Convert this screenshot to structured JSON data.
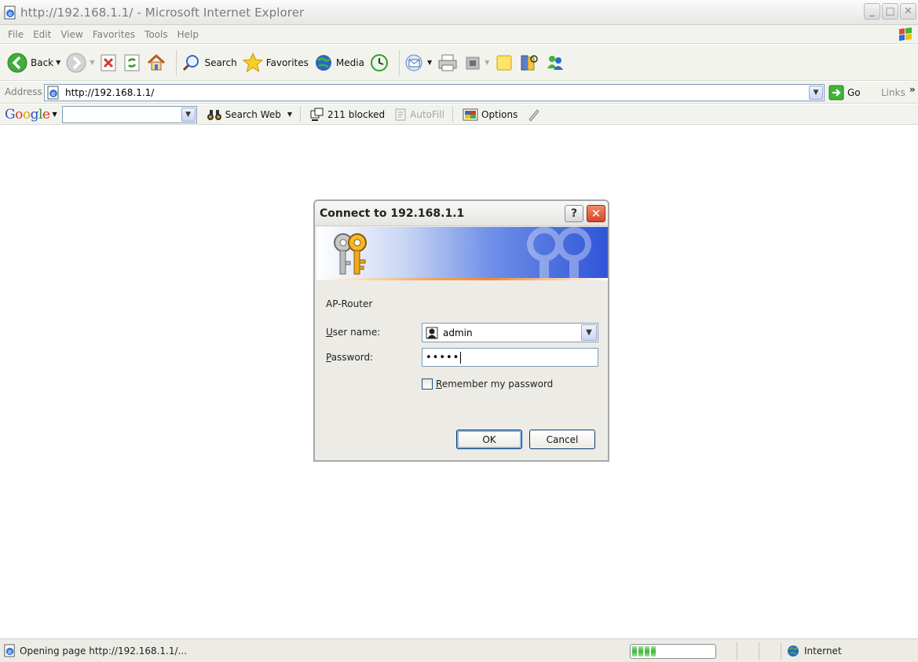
{
  "window": {
    "title": "http://192.168.1.1/ - Microsoft Internet Explorer",
    "minimize_glyph": "_",
    "maximize_glyph": "□",
    "close_glyph": "✕"
  },
  "menu": [
    "File",
    "Edit",
    "View",
    "Favorites",
    "Tools",
    "Help"
  ],
  "toolbar": {
    "back_label": "Back",
    "search_label": "Search",
    "favorites_label": "Favorites",
    "media_label": "Media"
  },
  "address": {
    "label": "Address",
    "url": "http://192.168.1.1/",
    "go_label": "Go",
    "links_label": "Links",
    "more_glyph": "»"
  },
  "google": {
    "logo": [
      "G",
      "o",
      "o",
      "g",
      "l",
      "e"
    ],
    "search_value": "",
    "search_web_label": "Search Web",
    "blocked_label": "211 blocked",
    "autofill_label": "AutoFill",
    "options_label": "Options"
  },
  "dialog": {
    "title": "Connect to 192.168.1.1",
    "help_glyph": "?",
    "close_glyph": "✕",
    "realm": "AP-Router",
    "username_label_u": "U",
    "username_label_rest": "ser name:",
    "password_label_u": "P",
    "password_label_rest": "assword:",
    "username_value": "admin",
    "password_value": "•••••",
    "remember_u": "R",
    "remember_rest": "emember my password",
    "ok_label": "OK",
    "cancel_label": "Cancel"
  },
  "status": {
    "text": "Opening page http://192.168.1.1/...",
    "progress_segments": 4,
    "zone_label": "Internet"
  },
  "colors": {
    "dialog_banner_blue": "#2f55d8",
    "close_red": "#d94425",
    "progress_green": "#3eb536"
  },
  "icons": {
    "back": "back-arrow-icon",
    "forward": "forward-arrow-icon",
    "stop": "stop-icon",
    "refresh": "refresh-icon",
    "home": "home-icon",
    "search": "magnifier-icon",
    "favorites": "star-icon",
    "media": "media-globe-icon",
    "history": "history-icon",
    "mail": "mail-icon",
    "print": "printer-icon",
    "keys": "keys-icon",
    "user": "user-icon",
    "internet_zone": "globe-icon"
  }
}
